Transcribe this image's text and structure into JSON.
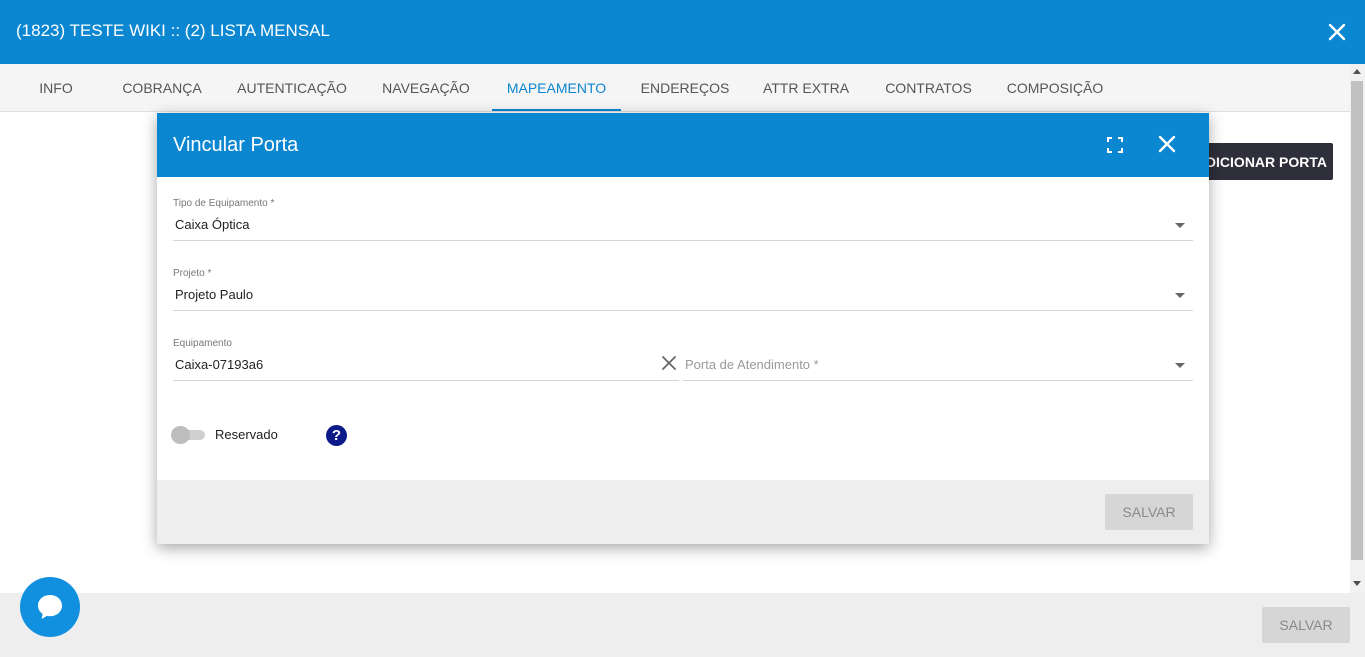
{
  "window": {
    "title": "(1823) TESTE WIKI :: (2) LISTA MENSAL",
    "close_icon": "close-icon"
  },
  "tabs": [
    {
      "label": "INFO",
      "active": false
    },
    {
      "label": "COBRANÇA",
      "active": false
    },
    {
      "label": "AUTENTICAÇÃO",
      "active": false
    },
    {
      "label": "NAVEGAÇÃO",
      "active": false
    },
    {
      "label": "MAPEAMENTO",
      "active": true
    },
    {
      "label": "ENDEREÇOS",
      "active": false
    },
    {
      "label": "ATTR EXTRA",
      "active": false
    },
    {
      "label": "CONTRATOS",
      "active": false
    },
    {
      "label": "COMPOSIÇÃO",
      "active": false
    }
  ],
  "page": {
    "add_port_label": "ADICIONAR PORTA",
    "save_label": "SALVAR"
  },
  "modal": {
    "title": "Vincular Porta",
    "fields": {
      "equipment_type": {
        "label": "Tipo de Equipamento *",
        "value": "Caixa Óptica"
      },
      "project": {
        "label": "Projeto *",
        "value": "Projeto Paulo"
      },
      "equipment": {
        "label": "Equipamento",
        "value": "Caixa-07193a6"
      },
      "service_port": {
        "placeholder": "Porta de Atendimento *"
      }
    },
    "reserved": {
      "label": "Reservado",
      "checked": false
    },
    "help_symbol": "?",
    "save_label": "SALVAR"
  },
  "colors": {
    "primary": "#0b86d1",
    "dark_button": "#2e2f3a",
    "help": "#0c1a8a"
  }
}
